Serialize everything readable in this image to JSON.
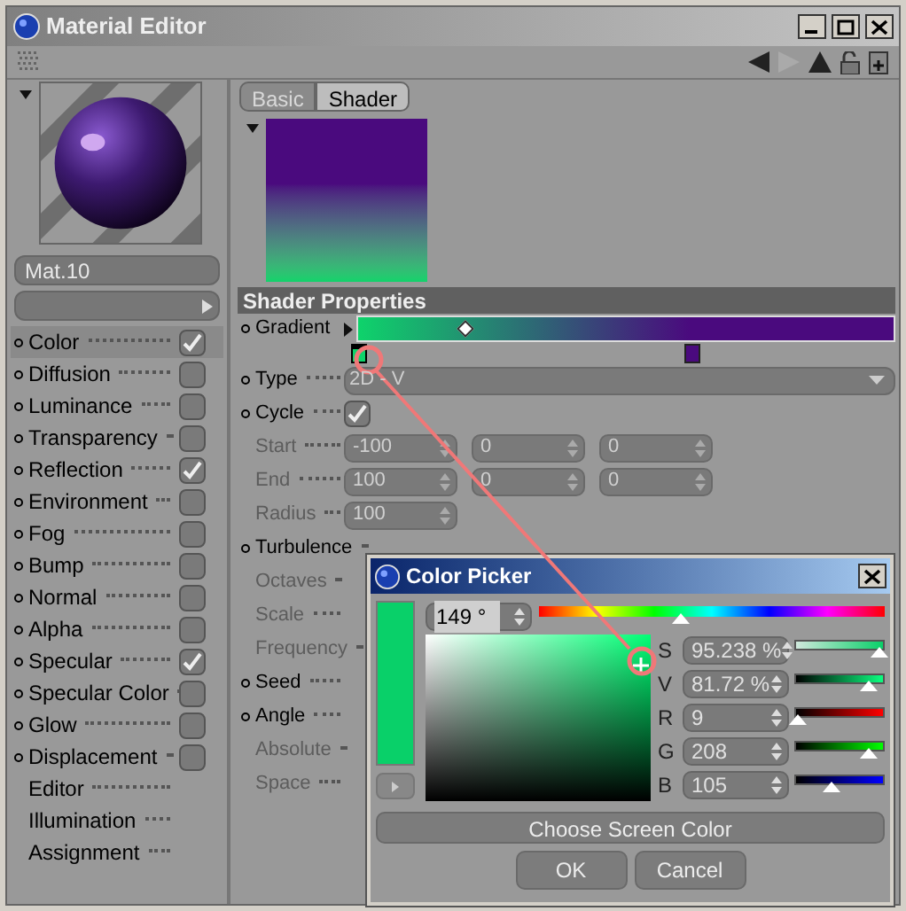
{
  "window": {
    "title": "Material Editor"
  },
  "material": {
    "name": "Mat.10"
  },
  "channels": [
    {
      "kind": "channel",
      "label": "Color",
      "checked": true,
      "selected": true
    },
    {
      "kind": "channel",
      "label": "Diffusion",
      "checked": false,
      "selected": false
    },
    {
      "kind": "channel",
      "label": "Luminance",
      "checked": false,
      "selected": false
    },
    {
      "kind": "channel",
      "label": "Transparency",
      "checked": false,
      "selected": false
    },
    {
      "kind": "channel",
      "label": "Reflection",
      "checked": true,
      "selected": false
    },
    {
      "kind": "channel",
      "label": "Environment",
      "checked": false,
      "selected": false
    },
    {
      "kind": "channel",
      "label": "Fog",
      "checked": false,
      "selected": false
    },
    {
      "kind": "channel",
      "label": "Bump",
      "checked": false,
      "selected": false
    },
    {
      "kind": "channel",
      "label": "Normal",
      "checked": false,
      "selected": false
    },
    {
      "kind": "channel",
      "label": "Alpha",
      "checked": false,
      "selected": false
    },
    {
      "kind": "channel",
      "label": "Specular",
      "checked": true,
      "selected": false
    },
    {
      "kind": "channel",
      "label": "Specular Color",
      "checked": false,
      "selected": false
    },
    {
      "kind": "channel",
      "label": "Glow",
      "checked": false,
      "selected": false
    },
    {
      "kind": "channel",
      "label": "Displacement",
      "checked": false,
      "selected": false
    },
    {
      "kind": "page",
      "label": "Editor",
      "selected": false
    },
    {
      "kind": "page",
      "label": "Illumination",
      "selected": false
    },
    {
      "kind": "page",
      "label": "Assignment",
      "selected": false
    }
  ],
  "tabs": [
    {
      "label": "Basic",
      "selected": false
    },
    {
      "label": "Shader",
      "selected": true
    }
  ],
  "shader_properties": {
    "title": "Shader Properties",
    "rows": [
      {
        "kind": "gradient",
        "label": "Gradient",
        "disabled": false,
        "knobs": [
          {
            "color": "#0ed36b",
            "selected": true
          },
          {
            "color": "#4a0a7e",
            "selected": false
          }
        ]
      },
      {
        "kind": "dropdown",
        "label": "Type",
        "disabled": false,
        "value": "2D - V"
      },
      {
        "kind": "checkbox",
        "label": "Cycle",
        "disabled": false,
        "checked": true
      },
      {
        "kind": "fields",
        "label": "Start",
        "disabled": true,
        "values": [
          "-100",
          "0",
          "0"
        ]
      },
      {
        "kind": "fields",
        "label": "End",
        "disabled": true,
        "values": [
          "100",
          "0",
          "0"
        ]
      },
      {
        "kind": "fields",
        "label": "Radius",
        "disabled": true,
        "values": [
          "100"
        ]
      },
      {
        "kind": "covered",
        "label": "Turbulence",
        "disabled": false
      },
      {
        "kind": "covered",
        "label": "Octaves",
        "disabled": true
      },
      {
        "kind": "covered",
        "label": "Scale",
        "disabled": true
      },
      {
        "kind": "covered",
        "label": "Frequency",
        "disabled": true
      },
      {
        "kind": "covered",
        "label": "Seed",
        "disabled": false
      },
      {
        "kind": "covered",
        "label": "Angle",
        "disabled": false
      },
      {
        "kind": "covered",
        "label": "Absolute",
        "disabled": true
      },
      {
        "kind": "covered",
        "label": "Space",
        "disabled": true
      }
    ]
  },
  "color_picker": {
    "title": "Color Picker",
    "color": "#09d069",
    "hue": {
      "value": "149 °",
      "level": 0.41
    },
    "sliders": [
      {
        "label": "S",
        "value": "95.238 %",
        "level": 0.95
      },
      {
        "label": "V",
        "value": "81.72 %",
        "level": 0.82
      },
      {
        "label": "R",
        "value": "9",
        "level": 0.035
      },
      {
        "label": "G",
        "value": "208",
        "level": 0.82
      },
      {
        "label": "B",
        "value": "105",
        "level": 0.41
      }
    ],
    "screen_button": "Choose Screen Color",
    "buttons": [
      "OK",
      "Cancel"
    ]
  }
}
